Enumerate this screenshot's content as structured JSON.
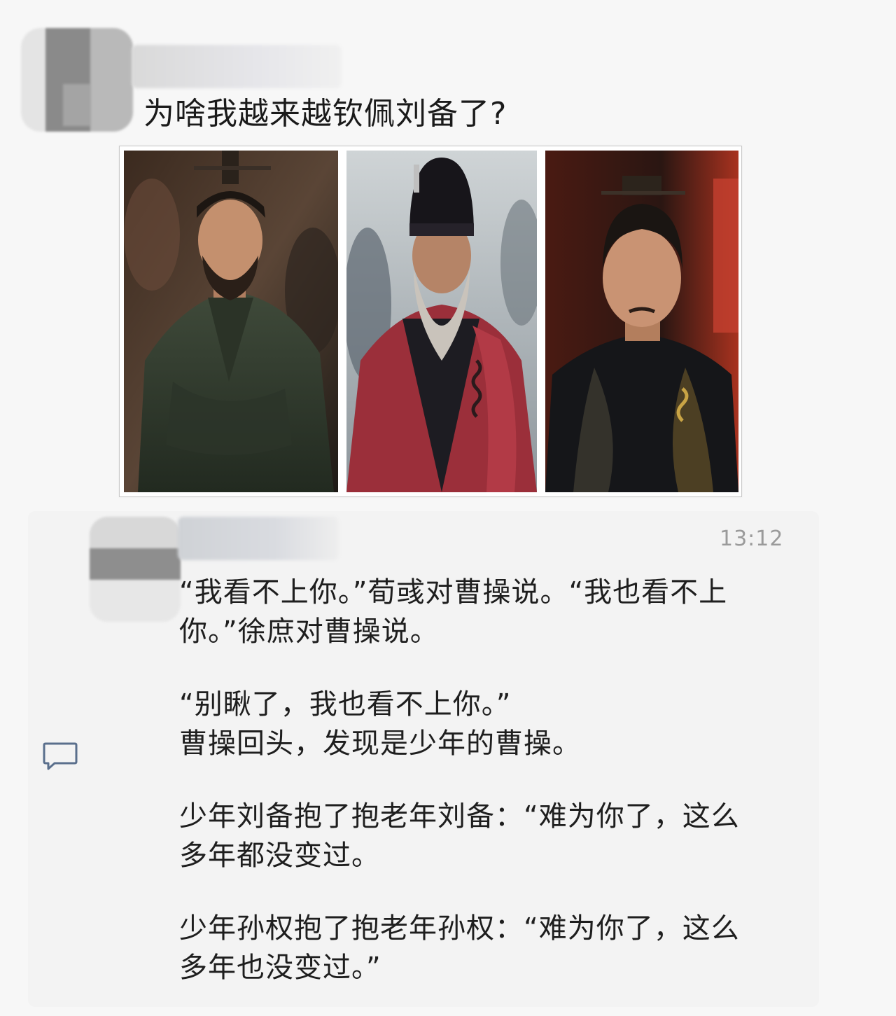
{
  "post1": {
    "title": "为啥我越来越钦佩刘备了?",
    "photos": [
      {
        "label": "photo-liu-bei"
      },
      {
        "label": "photo-cao-cao"
      },
      {
        "label": "photo-young-man"
      }
    ]
  },
  "post2": {
    "timestamp": "13:12",
    "paragraphs": [
      "“我看不上你。”荀彧对曹操说。“我也看不上\n你。”徐庶对曹操说。",
      "“别瞅了，我也看不上你。”\n曹操回头，发现是少年的曹操。",
      "少年刘备抱了抱老年刘备：“难为你了，这么\n多年都没变过。",
      "少年孙权抱了抱老年孙权：“难为你了，这么\n多年也没变过。”"
    ]
  },
  "icons": {
    "comment": "comment-bubble-icon"
  },
  "colors": {
    "background": "#f7f7f7",
    "card": "#f3f3f3",
    "timestamp": "#9a9a9a",
    "icon": "#5a6f8c"
  }
}
